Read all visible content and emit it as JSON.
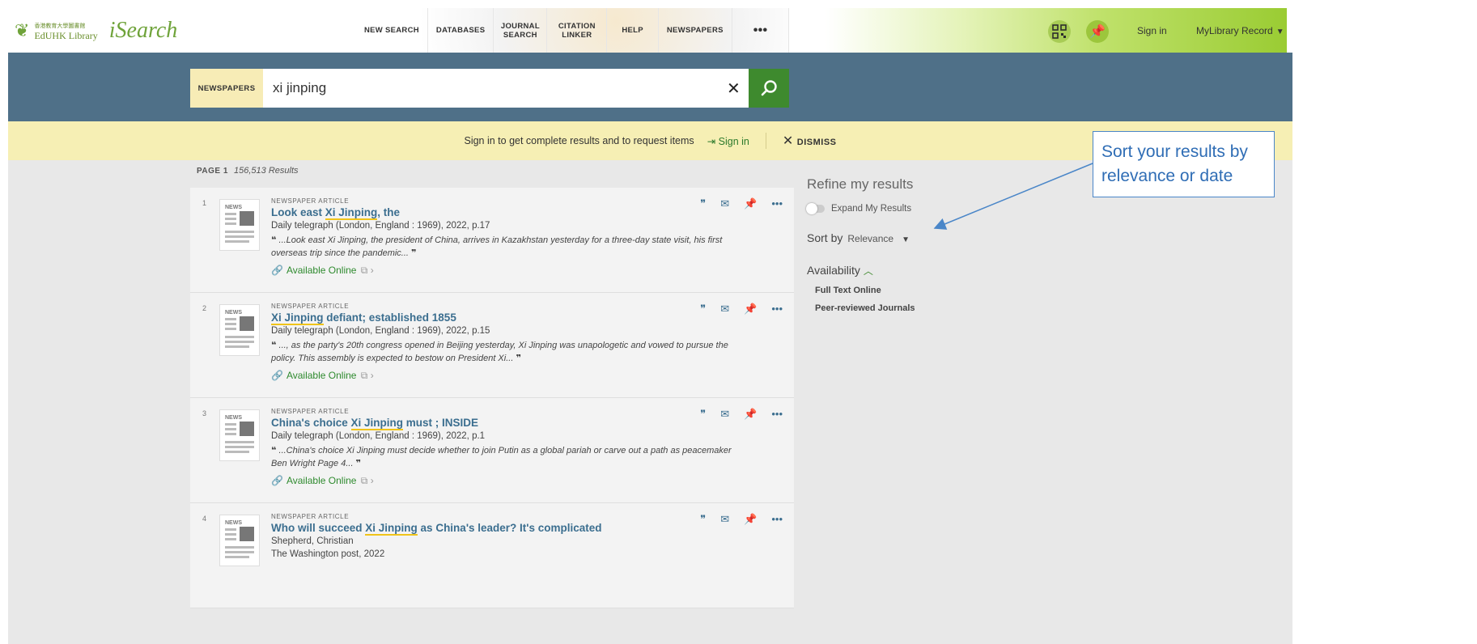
{
  "brand": {
    "institution": "EdUHK Library",
    "institution_chinese": "香港教育大學圖書館",
    "product": "iSearch"
  },
  "nav": {
    "items": [
      "NEW SEARCH",
      "DATABASES",
      "JOURNAL SEARCH",
      "CITATION LINKER",
      "HELP",
      "NEWSPAPERS"
    ],
    "more": "•••"
  },
  "account": {
    "signin": "Sign in",
    "mylibrary": "MyLibrary Record"
  },
  "search": {
    "scope": "NEWSPAPERS",
    "query": "xi jinping"
  },
  "banner": {
    "message": "Sign in to get complete results and to request items",
    "signin": "Sign in",
    "dismiss": "DISMISS"
  },
  "results_meta": {
    "page": "PAGE 1",
    "count": "156,513 Results"
  },
  "results": [
    {
      "num": "1",
      "type": "NEWSPAPER ARTICLE",
      "title_pre": "Look east ",
      "title_hl": "Xi Jinping",
      "title_post": ", the",
      "source": "Daily telegraph (London, England : 1969), 2022, p.17",
      "snippet": "...Look east Xi Jinping, the president of China, arrives in Kazakhstan yesterday for a three-day state visit, his first overseas trip since the pandemic...",
      "availability": "Available Online"
    },
    {
      "num": "2",
      "type": "NEWSPAPER ARTICLE",
      "title_pre": "",
      "title_hl": "Xi Jinping",
      "title_post": " defiant; established 1855",
      "source": "Daily telegraph (London, England : 1969), 2022, p.15",
      "snippet": "..., as the party's 20th congress opened in Beijing yesterday, Xi Jinping was unapologetic and vowed to pursue the policy. This assembly is expected to bestow on President Xi...",
      "availability": "Available Online"
    },
    {
      "num": "3",
      "type": "NEWSPAPER ARTICLE",
      "title_pre": "China's choice ",
      "title_hl": "Xi Jinping",
      "title_post": " must ; INSIDE",
      "source": "Daily telegraph (London, England : 1969), 2022, p.1",
      "snippet": "...China's choice Xi Jinping must decide whether to join Putin as a global pariah or carve out a path as peacemaker Ben Wright Page 4...",
      "availability": "Available Online"
    },
    {
      "num": "4",
      "type": "NEWSPAPER ARTICLE",
      "title_pre": "Who will succeed ",
      "title_hl": "Xi Jinping",
      "title_post": " as China's leader? It's complicated",
      "author": "Shepherd, Christian",
      "source": "The Washington post, 2022"
    }
  ],
  "thumb_label": "NEWS",
  "refine": {
    "title": "Refine my results",
    "expand": "Expand My Results",
    "sort_label": "Sort by",
    "sort_value": "Relevance",
    "availability": "Availability",
    "avail_items": [
      "Full Text Online",
      "Peer-reviewed Journals"
    ]
  },
  "annotation": {
    "line1": "Sort your results by",
    "line2": "relevance or date"
  },
  "colors": {
    "header_band": "#4f7088",
    "banner": "#f6efb4",
    "accent_green": "#3e8a2e",
    "title_blue": "#3b6e8f",
    "callout_blue": "#2f6db5"
  }
}
